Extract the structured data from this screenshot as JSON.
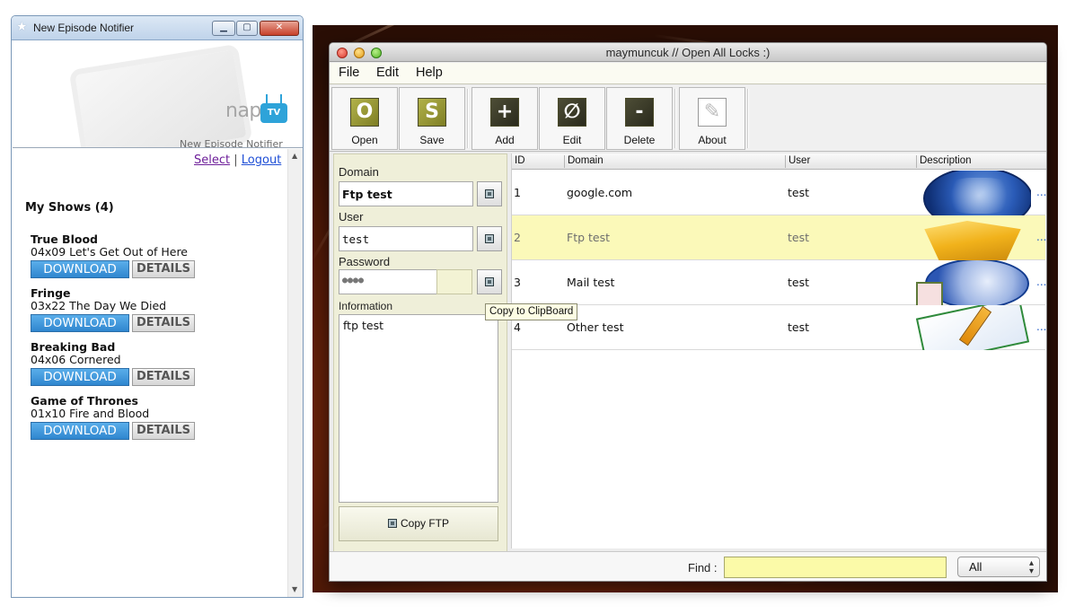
{
  "left_window": {
    "title": "New Episode Notifier",
    "banner": {
      "brand": "nap",
      "badge": "TV",
      "subtitle": "New Episode Notifier"
    },
    "links": {
      "select": "Select",
      "separator": "|",
      "logout": "Logout"
    },
    "my_shows_heading": "My Shows (4)",
    "download_label": "DOWNLOAD",
    "details_label": "DETAILS",
    "shows": [
      {
        "title": "True Blood",
        "episode": "04x09 Let's Get Out of Here"
      },
      {
        "title": "Fringe",
        "episode": "03x22 The Day We Died"
      },
      {
        "title": "Breaking Bad",
        "episode": "04x06 Cornered"
      },
      {
        "title": "Game of Thrones",
        "episode": "01x10 Fire and Blood"
      }
    ]
  },
  "right_window": {
    "title": "maymuncuk // Open All Locks :)",
    "menu": [
      "File",
      "Edit",
      "Help"
    ],
    "toolbar": [
      {
        "label": "Open",
        "icon_glyph": "O",
        "icon": "open-icon"
      },
      {
        "label": "Save",
        "icon_glyph": "S",
        "icon": "save-icon"
      },
      {
        "label": "Add",
        "icon_glyph": "+",
        "icon": "add-icon"
      },
      {
        "label": "Edit",
        "icon_glyph": "∅",
        "icon": "edit-icon"
      },
      {
        "label": "Delete",
        "icon_glyph": "-",
        "icon": "delete-icon"
      },
      {
        "label": "About",
        "icon_glyph": "✎",
        "icon": "about-icon"
      }
    ],
    "form": {
      "domain_label": "Domain",
      "domain_value": "Ftp test",
      "user_label": "User",
      "user_value": "test",
      "password_label": "Password",
      "password_value": "●●●●",
      "information_label": "Information",
      "information_value": "ftp test",
      "copy_ftp_label": "Copy FTP",
      "tooltip": "Copy to ClipBoard"
    },
    "table": {
      "columns": [
        "ID",
        "Domain",
        "User",
        "Description"
      ],
      "rows": [
        {
          "id": "1",
          "domain": "google.com",
          "user": "test",
          "desc_icon": "globe-icon"
        },
        {
          "id": "2",
          "domain": "Ftp test",
          "user": "test",
          "desc_icon": "box-icon"
        },
        {
          "id": "3",
          "domain": "Mail test",
          "user": "test",
          "desc_icon": "mail-icon"
        },
        {
          "id": "4",
          "domain": "Other test",
          "user": "test",
          "desc_icon": "notebook-icon"
        }
      ],
      "selected_row": 1,
      "more_glyph": "..."
    },
    "find": {
      "label": "Find :",
      "value": "",
      "filter_selected": "All"
    }
  },
  "colors": {
    "download_blue": "#2f86cf",
    "selected_row": "#fbf9b9",
    "find_input": "#fbfaa8",
    "toolbar_icon": "#9a9a36"
  }
}
